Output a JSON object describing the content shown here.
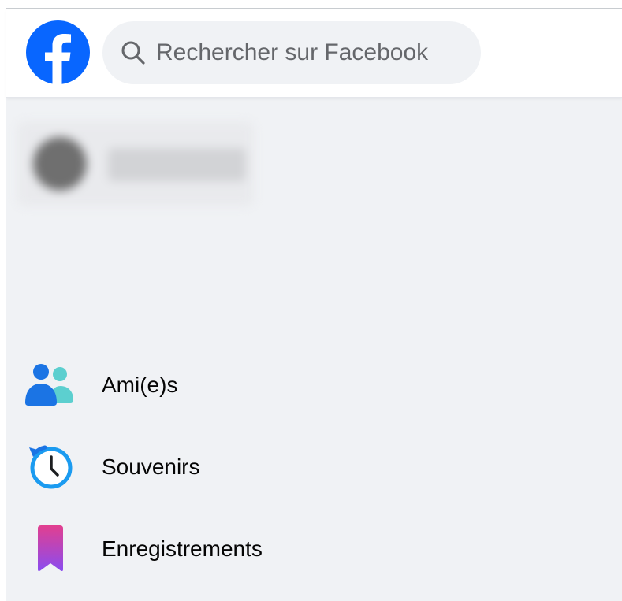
{
  "header": {
    "search": {
      "placeholder": "Rechercher sur Facebook",
      "icon": "search-icon"
    },
    "logo_icon": "facebook-logo-icon"
  },
  "sidebar": {
    "items": [
      {
        "label": "Ami(e)s",
        "icon": "friends-icon"
      },
      {
        "label": "Souvenirs",
        "icon": "memories-clock-icon"
      },
      {
        "label": "Enregistrements",
        "icon": "saved-bookmark-icon"
      }
    ]
  },
  "colors": {
    "brand_blue": "#0866ff",
    "page_bg": "#f0f2f5",
    "search_bg": "#f0f2f5",
    "text_primary": "#050505",
    "text_secondary": "#65676b"
  }
}
